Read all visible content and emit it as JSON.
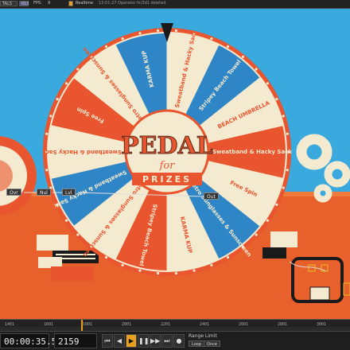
{
  "toolbar": {
    "left_label": "TALS",
    "badge": "013",
    "fps_label": "FPS:",
    "fps_value": "9",
    "mode_label": "Realtime",
    "message": "13:01:27 Operator fx/3d1 deleted."
  },
  "wheel": {
    "center_title": "PEDAL",
    "center_for": "for",
    "center_prizes": "PRIZES",
    "segments": [
      "Sweatband & Hacky Sack",
      "Stripey Beach Towel",
      "BEACH UMBRELLA",
      "Sweatband & Hacky Sack",
      "Free Spin",
      "Retro Sunglasses & Sunscreen",
      "KARMA KUP",
      "Stripey Beach Towel",
      "Retro Sunglasses & Sunscreen",
      "Sweatband & Hacky Sack",
      "Sweatband & Hacky Sack",
      "Free Spin",
      "Retro Sunglasses & Sunscreen",
      "KARMA KUP"
    ]
  },
  "nodes": {
    "ovr": "Ovr",
    "nul": "Nul",
    "lvl": "Lvl",
    "out": "Out"
  },
  "timeline": {
    "ticks": [
      "1401",
      "1601",
      "1801",
      "2001",
      "2201",
      "2401",
      "2601",
      "2801",
      "3001"
    ]
  },
  "playbar": {
    "timecode": "00:00:35.58",
    "frame": "2159",
    "range_limit_label": "Range Limit",
    "loop_label": "Loop",
    "once_label": "Once"
  },
  "colors": {
    "sky": "#3aa9de",
    "ground": "#e8602c",
    "wheel_red": "#e8552e",
    "wheel_cream": "#f4ead0",
    "wheel_blue": "#2f86c6",
    "accent": "#e8a020"
  }
}
